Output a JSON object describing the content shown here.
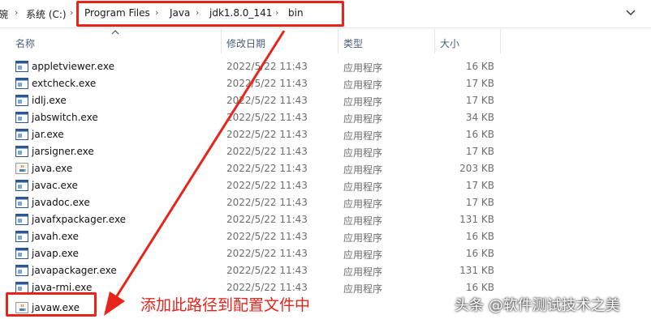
{
  "addressbar": {
    "crumbs": [
      "碗",
      "系统 (C:)",
      "Program Files",
      "Java",
      "jdk1.8.0_141",
      "bin"
    ]
  },
  "columns": {
    "name": "名称",
    "date": "修改日期",
    "type": "类型",
    "size": "大小"
  },
  "files": [
    {
      "name": "appletviewer.exe",
      "date": "2022/5/22 11:43",
      "type": "应用程序",
      "size": "16 KB",
      "icon": "exe-window-icon"
    },
    {
      "name": "extcheck.exe",
      "date": "2022/5/22 11:43",
      "type": "应用程序",
      "size": "17 KB",
      "icon": "exe-window-icon"
    },
    {
      "name": "idlj.exe",
      "date": "2022/5/22 11:43",
      "type": "应用程序",
      "size": "17 KB",
      "icon": "exe-window-icon"
    },
    {
      "name": "jabswitch.exe",
      "date": "2022/5/22 11:43",
      "type": "应用程序",
      "size": "34 KB",
      "icon": "exe-window-icon"
    },
    {
      "name": "jar.exe",
      "date": "2022/5/22 11:43",
      "type": "应用程序",
      "size": "16 KB",
      "icon": "exe-window-icon"
    },
    {
      "name": "jarsigner.exe",
      "date": "2022/5/22 11:43",
      "type": "应用程序",
      "size": "17 KB",
      "icon": "exe-window-icon"
    },
    {
      "name": "java.exe",
      "date": "2022/5/22 11:43",
      "type": "应用程序",
      "size": "203 KB",
      "icon": "java-cup-icon"
    },
    {
      "name": "javac.exe",
      "date": "2022/5/22 11:43",
      "type": "应用程序",
      "size": "17 KB",
      "icon": "exe-window-icon"
    },
    {
      "name": "javadoc.exe",
      "date": "2022/5/22 11:43",
      "type": "应用程序",
      "size": "17 KB",
      "icon": "exe-window-icon"
    },
    {
      "name": "javafxpackager.exe",
      "date": "2022/5/22 11:43",
      "type": "应用程序",
      "size": "131 KB",
      "icon": "exe-window-icon"
    },
    {
      "name": "javah.exe",
      "date": "2022/5/22 11:43",
      "type": "应用程序",
      "size": "16 KB",
      "icon": "exe-window-icon"
    },
    {
      "name": "javap.exe",
      "date": "2022/5/22 11:43",
      "type": "应用程序",
      "size": "16 KB",
      "icon": "exe-window-icon"
    },
    {
      "name": "javapackager.exe",
      "date": "2022/5/22 11:43",
      "type": "应用程序",
      "size": "131 KB",
      "icon": "exe-window-icon"
    },
    {
      "name": "java-rmi.exe",
      "date": "2022/5/22 11:43",
      "type": "应用程序",
      "size": "16 KB",
      "icon": "exe-window-icon"
    },
    {
      "name": "javaw.exe",
      "date": "",
      "type": "",
      "size": "",
      "icon": "java-cup-icon"
    }
  ],
  "annotation": {
    "text": "添加此路径到配置文件中",
    "color": "#e8231b"
  },
  "watermark": "头条 @软件测试技术之美"
}
